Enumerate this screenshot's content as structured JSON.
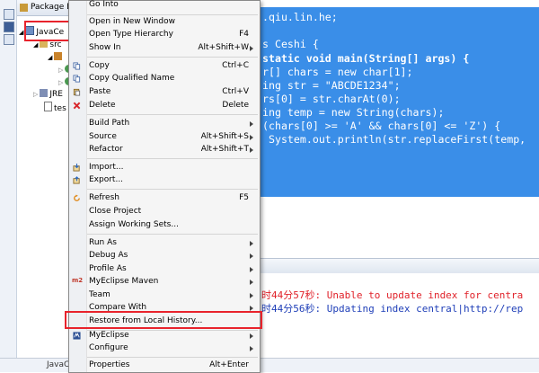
{
  "package_explorer": {
    "title": "Package E",
    "project": "JavaCe",
    "src": "src",
    "jre": "JRE",
    "file": "tes"
  },
  "editor": {
    "lines": [
      ".qiu.lin.he;",
      "",
      "s Ceshi {",
      "static void main(String[] args) {",
      "r[] chars = new char[1];",
      "ing str = \"ABCDE1234\";",
      "rs[0] = str.charAt(0);",
      "ing temp = new String(chars);",
      "(chars[0] >= 'A' && chars[0] <= 'Z') {",
      " System.out.println(str.replaceFirst(temp,"
    ]
  },
  "console": {
    "line1": "时44分57秒: Unable to update index for centra",
    "line2": "时44分56秒: Updating index central|http://rep",
    "line1_color": "#e0222a",
    "line2_color": "#1f3fb8"
  },
  "status_bar": {
    "label": "JavaCe"
  },
  "context_menu": {
    "items": [
      {
        "label": "Go Into",
        "shortcut": "",
        "arrow": false,
        "icon": ""
      },
      {
        "label": "Open in New Window",
        "shortcut": "",
        "arrow": false,
        "icon": ""
      },
      {
        "label": "Open Type Hierarchy",
        "shortcut": "F4",
        "arrow": false,
        "icon": ""
      },
      {
        "label": "Show In",
        "shortcut": "Alt+Shift+W",
        "arrow": true,
        "icon": ""
      },
      {
        "label": "Copy",
        "shortcut": "Ctrl+C",
        "arrow": false,
        "icon": "copy-icon"
      },
      {
        "label": "Copy Qualified Name",
        "shortcut": "",
        "arrow": false,
        "icon": "copy-icon"
      },
      {
        "label": "Paste",
        "shortcut": "Ctrl+V",
        "arrow": false,
        "icon": "paste-icon"
      },
      {
        "label": "Delete",
        "shortcut": "Delete",
        "arrow": false,
        "icon": "delete-icon"
      },
      {
        "label": "Build Path",
        "shortcut": "",
        "arrow": true,
        "icon": ""
      },
      {
        "label": "Source",
        "shortcut": "Alt+Shift+S",
        "arrow": true,
        "icon": ""
      },
      {
        "label": "Refactor",
        "shortcut": "Alt+Shift+T",
        "arrow": true,
        "icon": ""
      },
      {
        "label": "Import...",
        "shortcut": "",
        "arrow": false,
        "icon": "import-icon"
      },
      {
        "label": "Export...",
        "shortcut": "",
        "arrow": false,
        "icon": "export-icon"
      },
      {
        "label": "Refresh",
        "shortcut": "F5",
        "arrow": false,
        "icon": "refresh-icon"
      },
      {
        "label": "Close Project",
        "shortcut": "",
        "arrow": false,
        "icon": ""
      },
      {
        "label": "Assign Working Sets...",
        "shortcut": "",
        "arrow": false,
        "icon": ""
      },
      {
        "label": "Run As",
        "shortcut": "",
        "arrow": true,
        "icon": ""
      },
      {
        "label": "Debug As",
        "shortcut": "",
        "arrow": true,
        "icon": ""
      },
      {
        "label": "Profile As",
        "shortcut": "",
        "arrow": true,
        "icon": ""
      },
      {
        "label": "MyEclipse Maven",
        "shortcut": "",
        "arrow": true,
        "icon": "maven-icon"
      },
      {
        "label": "Team",
        "shortcut": "",
        "arrow": true,
        "icon": ""
      },
      {
        "label": "Compare With",
        "shortcut": "",
        "arrow": true,
        "icon": ""
      },
      {
        "label": "Restore from Local History...",
        "shortcut": "",
        "arrow": false,
        "icon": ""
      },
      {
        "label": "MyEclipse",
        "shortcut": "",
        "arrow": true,
        "icon": "myeclipse-icon"
      },
      {
        "label": "Configure",
        "shortcut": "",
        "arrow": true,
        "icon": ""
      },
      {
        "label": "Properties",
        "shortcut": "Alt+Enter",
        "arrow": false,
        "icon": ""
      }
    ]
  },
  "colors": {
    "selection": "#3a8ee8",
    "highlight_box": "#e8232c"
  }
}
